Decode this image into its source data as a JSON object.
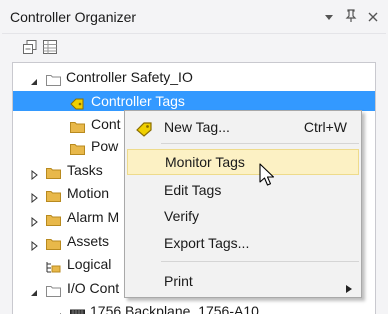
{
  "window": {
    "title": "Controller Organizer",
    "icons": [
      "dropdown-arrow-icon",
      "pin-icon",
      "close-icon"
    ]
  },
  "toolbar": {
    "icons": [
      "collapse-all-icon",
      "grid-view-icon"
    ]
  },
  "tree": {
    "items": [
      {
        "label": "Controller Safety_IO",
        "icon": "folder-icon",
        "expanded": true
      },
      {
        "label": "Controller Tags",
        "icon": "tag-icon",
        "selected": true
      },
      {
        "label": "Cont",
        "icon": "folder-icon"
      },
      {
        "label": "Pow",
        "icon": "folder-icon"
      },
      {
        "label": "Tasks",
        "icon": "folder-icon",
        "expanded": false
      },
      {
        "label": "Motion",
        "icon": "folder-icon",
        "expanded": false
      },
      {
        "label": "Alarm M",
        "icon": "folder-icon",
        "expanded": false
      },
      {
        "label": "Assets",
        "icon": "folder-icon",
        "expanded": false
      },
      {
        "label": "Logical",
        "icon": "logical-model-icon"
      },
      {
        "label": "I/O Cont",
        "icon": "folder-icon",
        "expanded": true
      },
      {
        "label": "1756 Backplane, 1756-A10",
        "icon": "backplane-icon",
        "expanded": true
      }
    ]
  },
  "context_menu": {
    "items": [
      {
        "label": "New Tag...",
        "shortcut": "Ctrl+W",
        "icon": "tag-icon"
      },
      {
        "label": "Monitor Tags",
        "highlighted": true
      },
      {
        "label": "Edit Tags"
      },
      {
        "label": "Verify"
      },
      {
        "label": "Export Tags..."
      },
      {
        "label": "Print",
        "has_submenu": true
      }
    ]
  },
  "colors": {
    "selection": "#3399ff",
    "menu_hover": "#fcf1c4",
    "folder": "#e8b84a",
    "tag": "#f0d000"
  }
}
